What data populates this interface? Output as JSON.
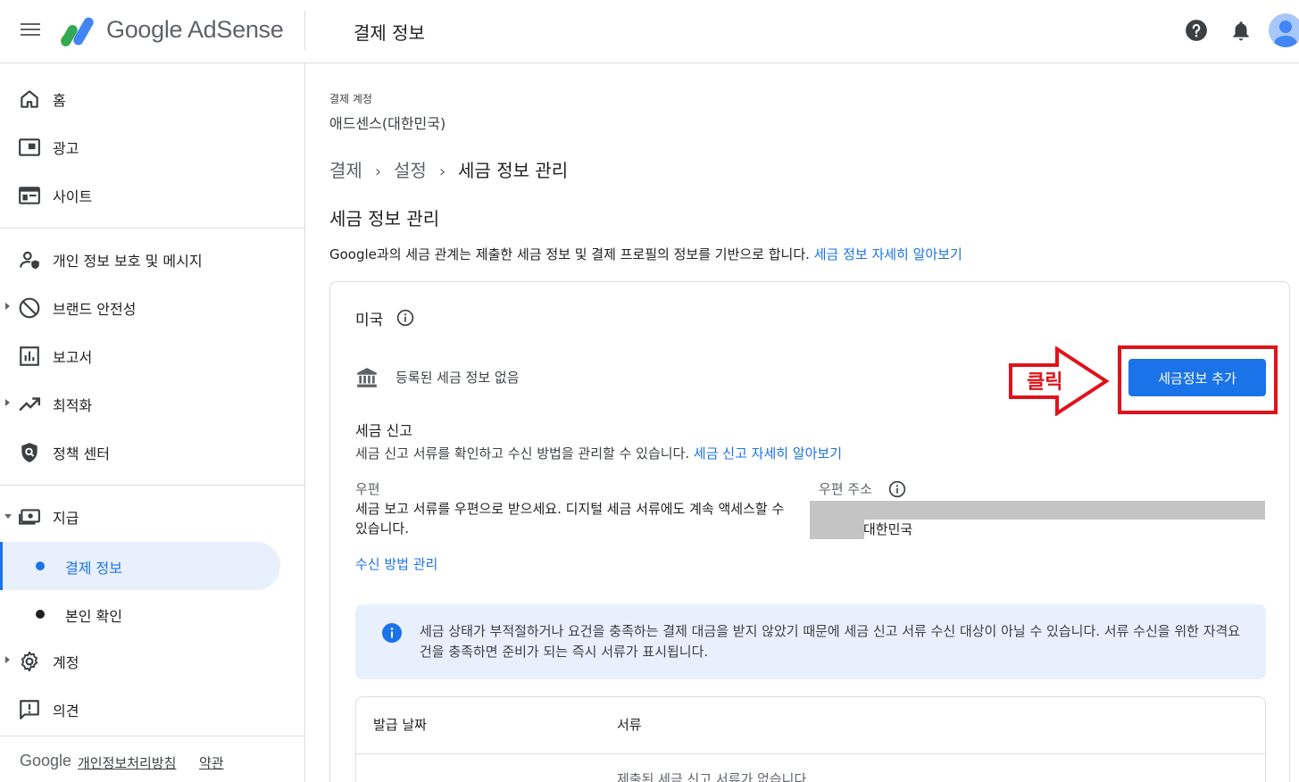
{
  "header": {
    "brand": "Google AdSense",
    "page_title": "결제 정보"
  },
  "sidebar": {
    "items": [
      {
        "label": "홈",
        "icon": "home-icon"
      },
      {
        "label": "광고",
        "icon": "ads-icon"
      },
      {
        "label": "사이트",
        "icon": "sites-icon"
      },
      {
        "label": "개인 정보 보호 및 메시지",
        "icon": "privacy-icon"
      },
      {
        "label": "브랜드 안전성",
        "icon": "block-icon"
      },
      {
        "label": "보고서",
        "icon": "reports-icon"
      },
      {
        "label": "최적화",
        "icon": "trending-icon"
      },
      {
        "label": "정책 센터",
        "icon": "shield-icon"
      },
      {
        "label": "지급",
        "icon": "payments-icon"
      },
      {
        "label": "계정",
        "icon": "gear-icon"
      },
      {
        "label": "의견",
        "icon": "feedback-icon"
      }
    ],
    "sub_items": [
      {
        "label": "결제 정보",
        "active": true
      },
      {
        "label": "본인 확인",
        "active": false
      }
    ],
    "footer": {
      "google": "Google",
      "privacy": "개인정보처리방침",
      "terms": "약관"
    }
  },
  "main": {
    "account_label": "결제 계정",
    "account_name": "애드센스(대한민국)",
    "breadcrumb": [
      "결제",
      "설정",
      "세금 정보 관리"
    ],
    "title": "세금 정보 관리",
    "description": "Google과의 세금 관계는 제출한 세금 정보 및 결제 프로필의 정보를 기반으로 합니다.",
    "description_link": "세금 정보 자세히 알아보기",
    "card": {
      "country": "미국",
      "no_tax_info": "등록된 세금 정보 없음",
      "add_button": "세금정보 추가",
      "annotation": "클릭",
      "filing_title": "세금 신고",
      "filing_desc": "세금 신고 서류를 확인하고 수신 방법을 관리할 수 있습니다.",
      "filing_link": "세금 신고 자세히 알아보기",
      "mail_label": "우편",
      "mail_text": "세금 보고 서류를 우편으로 받으세요. 디지털 세금 서류에도 계속 액세스할 수 있습니다.",
      "address_label": "우편 주소",
      "address_country": "대한민국",
      "manage_link": "수신 방법 관리",
      "notice": "세금 상태가 부적절하거나 요건을 충족하는 결제 대금을 받지 않았기 때문에 세금 신고 서류 수신 대상이 아닐 수 있습니다. 서류 수신을 위한 자격요건을 충족하면 준비가 되는 즉시 서류가 표시됩니다.",
      "table": {
        "headers": [
          "발급 날짜",
          "서류"
        ],
        "empty": "제출된 세금 신고 서류가 없습니다"
      }
    }
  },
  "colors": {
    "primary": "#1a73e8",
    "annotation_red": "#e0121a",
    "active_bg": "#e8f0fe"
  }
}
